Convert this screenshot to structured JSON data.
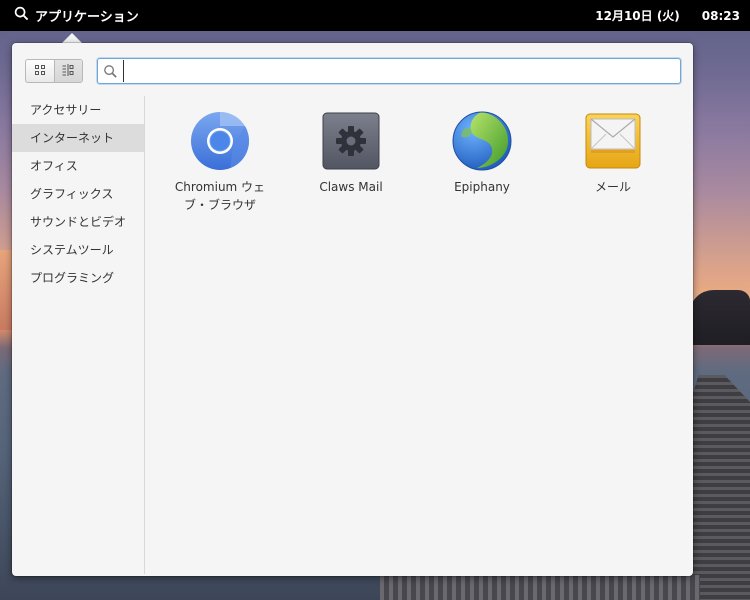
{
  "panel": {
    "applications_label": "アプリケーション",
    "date": "12月10日 (火)",
    "time": "08:23"
  },
  "search": {
    "value": "",
    "placeholder": ""
  },
  "view_modes": [
    "grid-view-icon",
    "category-view-icon"
  ],
  "categories": [
    {
      "label": "アクセサリー",
      "selected": false
    },
    {
      "label": "インターネット",
      "selected": true
    },
    {
      "label": "オフィス",
      "selected": false
    },
    {
      "label": "グラフィックス",
      "selected": false
    },
    {
      "label": "サウンドとビデオ",
      "selected": false
    },
    {
      "label": "システムツール",
      "selected": false
    },
    {
      "label": "プログラミング",
      "selected": false
    }
  ],
  "apps": [
    {
      "line1": "Chromium ウェ",
      "line2": "ブ・ブラウザ",
      "icon": "chromium-icon"
    },
    {
      "line1": "Claws Mail",
      "line2": "",
      "icon": "claws-mail-icon"
    },
    {
      "line1": "Epiphany",
      "line2": "",
      "icon": "epiphany-icon"
    },
    {
      "line1": "メール",
      "line2": "",
      "icon": "mail-icon"
    }
  ],
  "colors": {
    "panel_bg": "#000000",
    "popover_bg": "#f5f5f5",
    "selection_bg": "#dcdcdc",
    "search_focus": "#6fa6d8"
  }
}
